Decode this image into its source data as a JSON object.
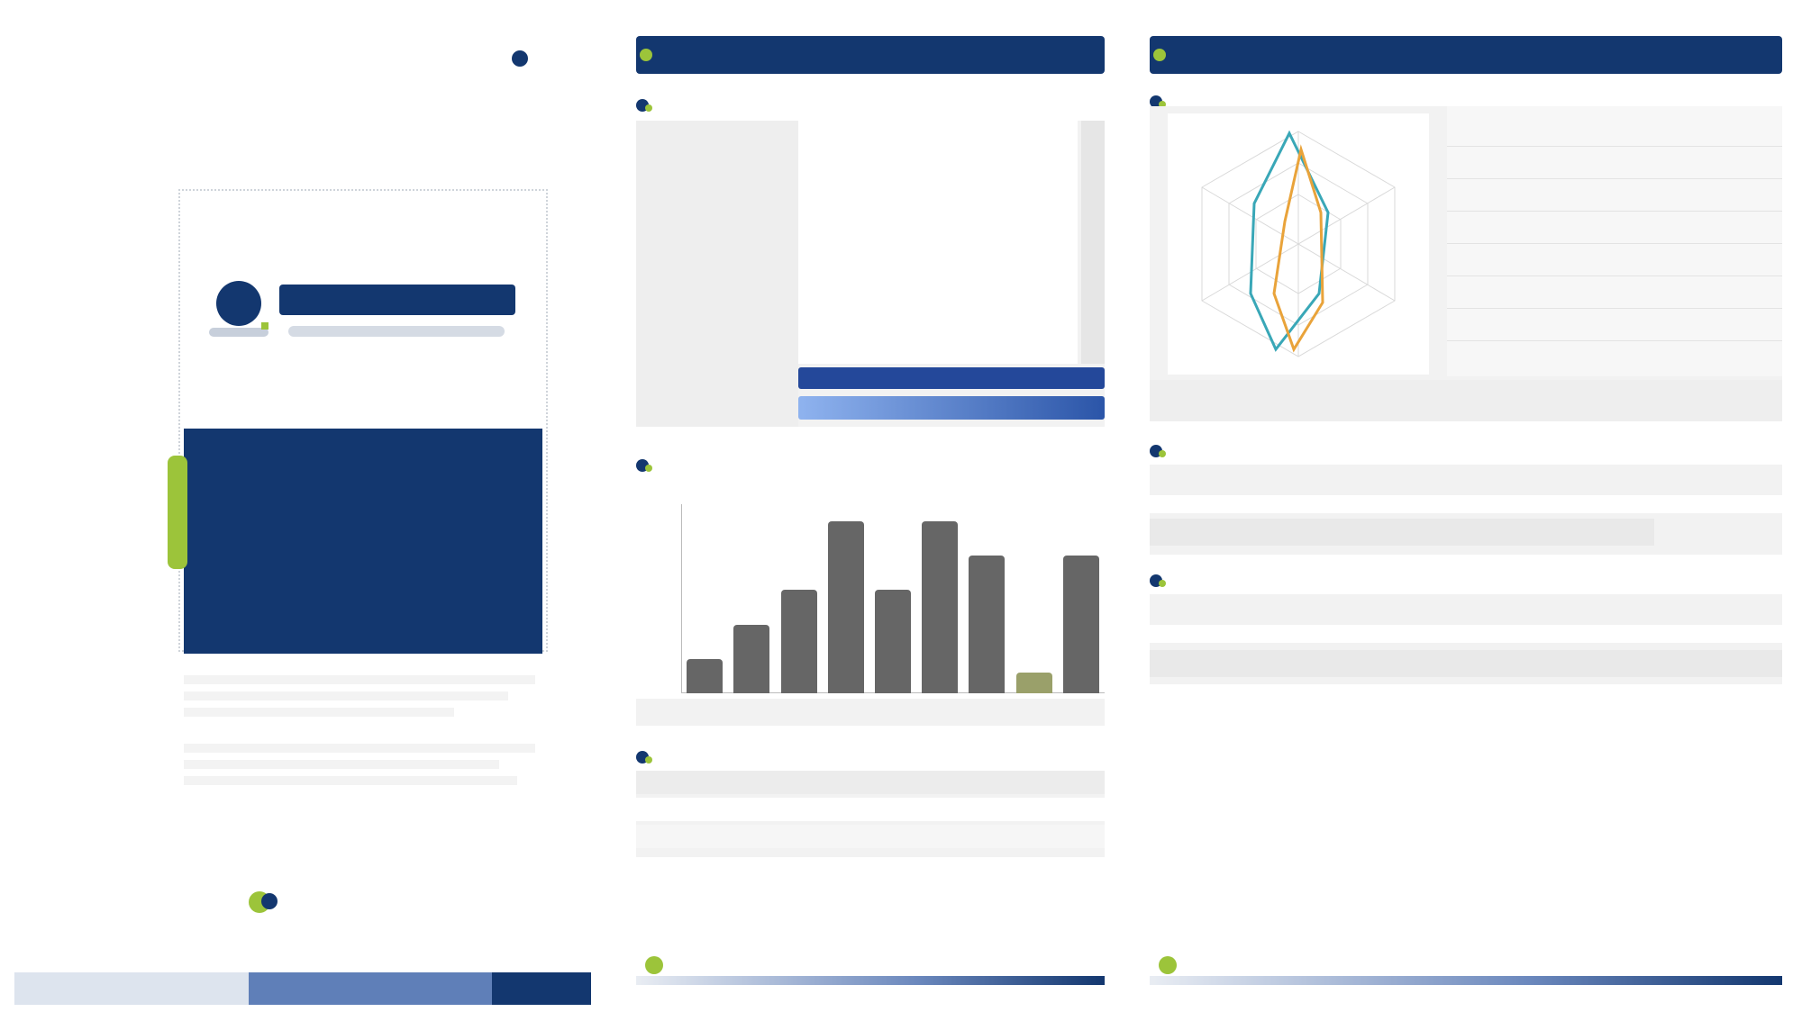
{
  "cover": {
    "corner_logo_text": "",
    "title": "",
    "subtitle": "",
    "menu_items": [
      {
        "code": "",
        "text": ""
      },
      {
        "code": "",
        "text": ""
      },
      {
        "code": "",
        "text": ""
      },
      {
        "code": "",
        "text": ""
      }
    ],
    "watermark_left": "",
    "footer_brand": ""
  },
  "page2": {
    "header_title": "",
    "section1_title": "",
    "table": {
      "rows": [
        {
          "label": "",
          "value": ""
        },
        {
          "label": "",
          "value": ""
        },
        {
          "label": "",
          "value": ""
        },
        {
          "label": "",
          "value": ""
        },
        {
          "label": "",
          "value": ""
        },
        {
          "label": "",
          "value": ""
        },
        {
          "label": "",
          "value": ""
        },
        {
          "label": "",
          "value": ""
        }
      ]
    },
    "section2_title": "",
    "section3_title": "",
    "footer_text": ""
  },
  "page3": {
    "header_title": "",
    "section1_title": "",
    "section2_title": "",
    "section3_title": "",
    "footer_text": ""
  },
  "colors": {
    "navy": "#13376f",
    "accent": "#9cc43a",
    "teal": "#39a7b7",
    "orange": "#e9a33a",
    "gray_bar": "#666666"
  },
  "chart_data": {
    "type": "bar",
    "categories": [
      "",
      "",
      "",
      "",
      "",
      "",
      "",
      "",
      ""
    ],
    "values": [
      1,
      2,
      3,
      5,
      3,
      5,
      4,
      0.6,
      4
    ],
    "highlight_index": 7,
    "title": "",
    "xlabel": "",
    "ylabel": "",
    "ylim": [
      0,
      5.5
    ]
  }
}
